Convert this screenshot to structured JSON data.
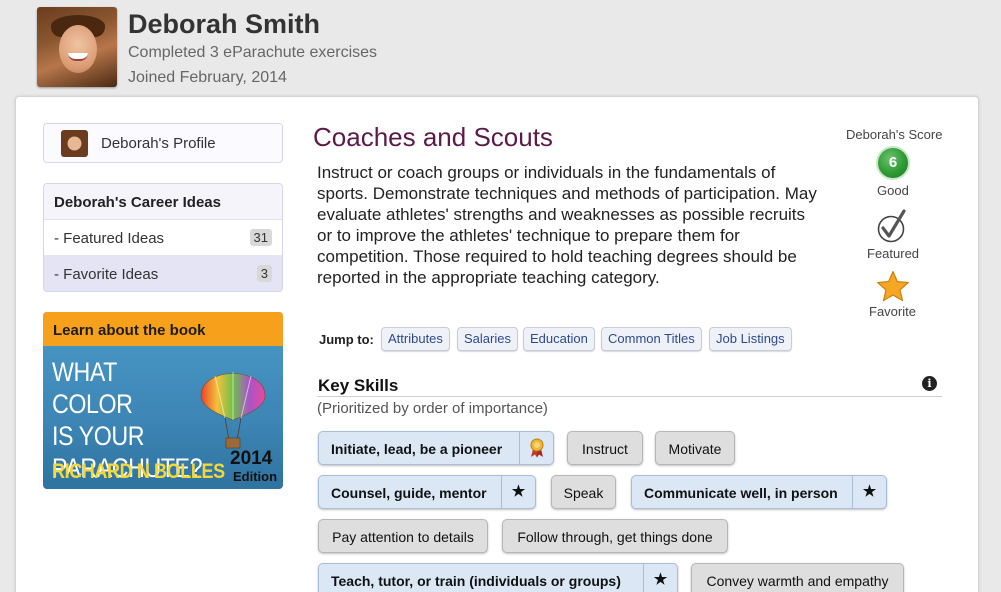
{
  "user": {
    "name": "Deborah Smith",
    "completed": "Completed 3 eParachute exercises",
    "joined": "Joined February, 2014"
  },
  "sidebar": {
    "profile_label": "Deborah's Profile",
    "ideas_heading": "Deborah's Career Ideas",
    "items": [
      {
        "label": "- Featured Ideas",
        "count": "31"
      },
      {
        "label": "- Favorite Ideas",
        "count": "3"
      }
    ],
    "book": {
      "heading": "Learn about the book",
      "title_line1": "WHAT COLOR",
      "title_line2": "IS YOUR",
      "title_line3": "PARACHUTE?",
      "author": "RICHARD N BOLLES",
      "year": "2014",
      "edition": "Edition"
    }
  },
  "career": {
    "title": "Coaches and Scouts",
    "description": "Instruct or coach groups or individuals in the fundamentals of sports. Demonstrate techniques and methods of participation. May evaluate athletes' strengths and weaknesses as possible recruits or to improve the athletes' technique to prepare them for competition. Those required to hold teaching degrees should be reported in the appropriate teaching category."
  },
  "jump": {
    "label": "Jump to:",
    "links": [
      "Attributes",
      "Salaries",
      "Education",
      "Common Titles",
      "Job Listings"
    ]
  },
  "score": {
    "label": "Deborah's Score",
    "value": "6",
    "rating": "Good",
    "featured_label": "Featured",
    "favorite_label": "Favorite",
    "badge_color": "#2f9a34",
    "star_color": "#f5a623"
  },
  "key_skills": {
    "title": "Key Skills",
    "subtitle": "(Prioritized by order of importance)",
    "skills": [
      {
        "label": "Initiate, lead, be a pioneer",
        "style": "highlight",
        "tag": "award-icon"
      },
      {
        "label": "Instruct",
        "style": "plain"
      },
      {
        "label": "Motivate",
        "style": "plain"
      },
      {
        "label": "Counsel, guide, mentor",
        "style": "highlight",
        "tag": "star-icon",
        "tag_glyph": "★"
      },
      {
        "label": "Speak",
        "style": "plain"
      },
      {
        "label": "Communicate well, in person",
        "style": "highlight",
        "tag": "star-icon",
        "tag_glyph": "★"
      },
      {
        "label": "Pay attention to details",
        "style": "plain"
      },
      {
        "label": "Follow through, get things done",
        "style": "plain"
      },
      {
        "label": "Teach, tutor, or train (individuals or groups)",
        "style": "highlight",
        "tag": "star-icon",
        "tag_glyph": "★"
      },
      {
        "label": "Convey warmth and empathy",
        "style": "plain"
      }
    ]
  }
}
